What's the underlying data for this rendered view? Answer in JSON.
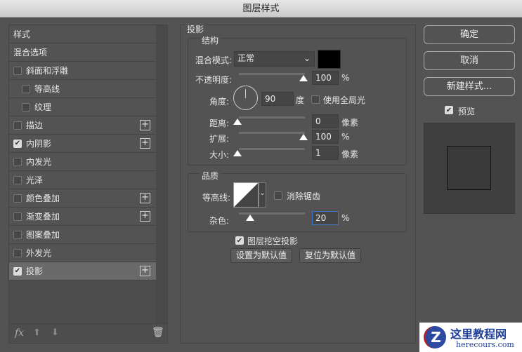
{
  "title": "图层样式",
  "left": {
    "items": [
      {
        "label": "样式",
        "cb": null,
        "plus": false
      },
      {
        "label": "混合选项",
        "cb": null,
        "plus": false
      },
      {
        "label": "斜面和浮雕",
        "cb": false,
        "plus": false
      },
      {
        "label": "等高线",
        "cb": false,
        "plus": false,
        "indent": true
      },
      {
        "label": "纹理",
        "cb": false,
        "plus": false,
        "indent": true
      },
      {
        "label": "描边",
        "cb": false,
        "plus": true
      },
      {
        "label": "内阴影",
        "cb": true,
        "plus": true
      },
      {
        "label": "内发光",
        "cb": false,
        "plus": false
      },
      {
        "label": "光泽",
        "cb": false,
        "plus": false
      },
      {
        "label": "颜色叠加",
        "cb": false,
        "plus": true
      },
      {
        "label": "渐变叠加",
        "cb": false,
        "plus": true
      },
      {
        "label": "图案叠加",
        "cb": false,
        "plus": false
      },
      {
        "label": "外发光",
        "cb": false,
        "plus": false
      },
      {
        "label": "投影",
        "cb": true,
        "plus": true,
        "selected": true
      }
    ],
    "fx": "fx"
  },
  "panel": {
    "title": "投影",
    "structure": {
      "title": "结构",
      "blend_label": "混合模式:",
      "blend_value": "正常",
      "color": "#000000",
      "opacity_label": "不透明度:",
      "opacity": "100",
      "opacity_unit": "%",
      "angle_label": "角度:",
      "angle": "90",
      "angle_unit": "度",
      "global_light": "使用全局光",
      "distance_label": "距离:",
      "distance": "0",
      "distance_unit": "像素",
      "spread_label": "扩展:",
      "spread": "100",
      "spread_unit": "%",
      "size_label": "大小:",
      "size": "1",
      "size_unit": "像素"
    },
    "quality": {
      "title": "品质",
      "contour_label": "等高线:",
      "antialias": "消除锯齿",
      "noise_label": "杂色:",
      "noise": "20",
      "noise_unit": "%"
    },
    "knockout": "图层挖空投影",
    "set_default": "设置为默认值",
    "reset_default": "复位为默认值"
  },
  "right": {
    "ok": "确定",
    "cancel": "取消",
    "new_style": "新建样式...",
    "preview": "预览"
  },
  "watermark": {
    "name": "这里教程网",
    "url": "herecours.com"
  }
}
